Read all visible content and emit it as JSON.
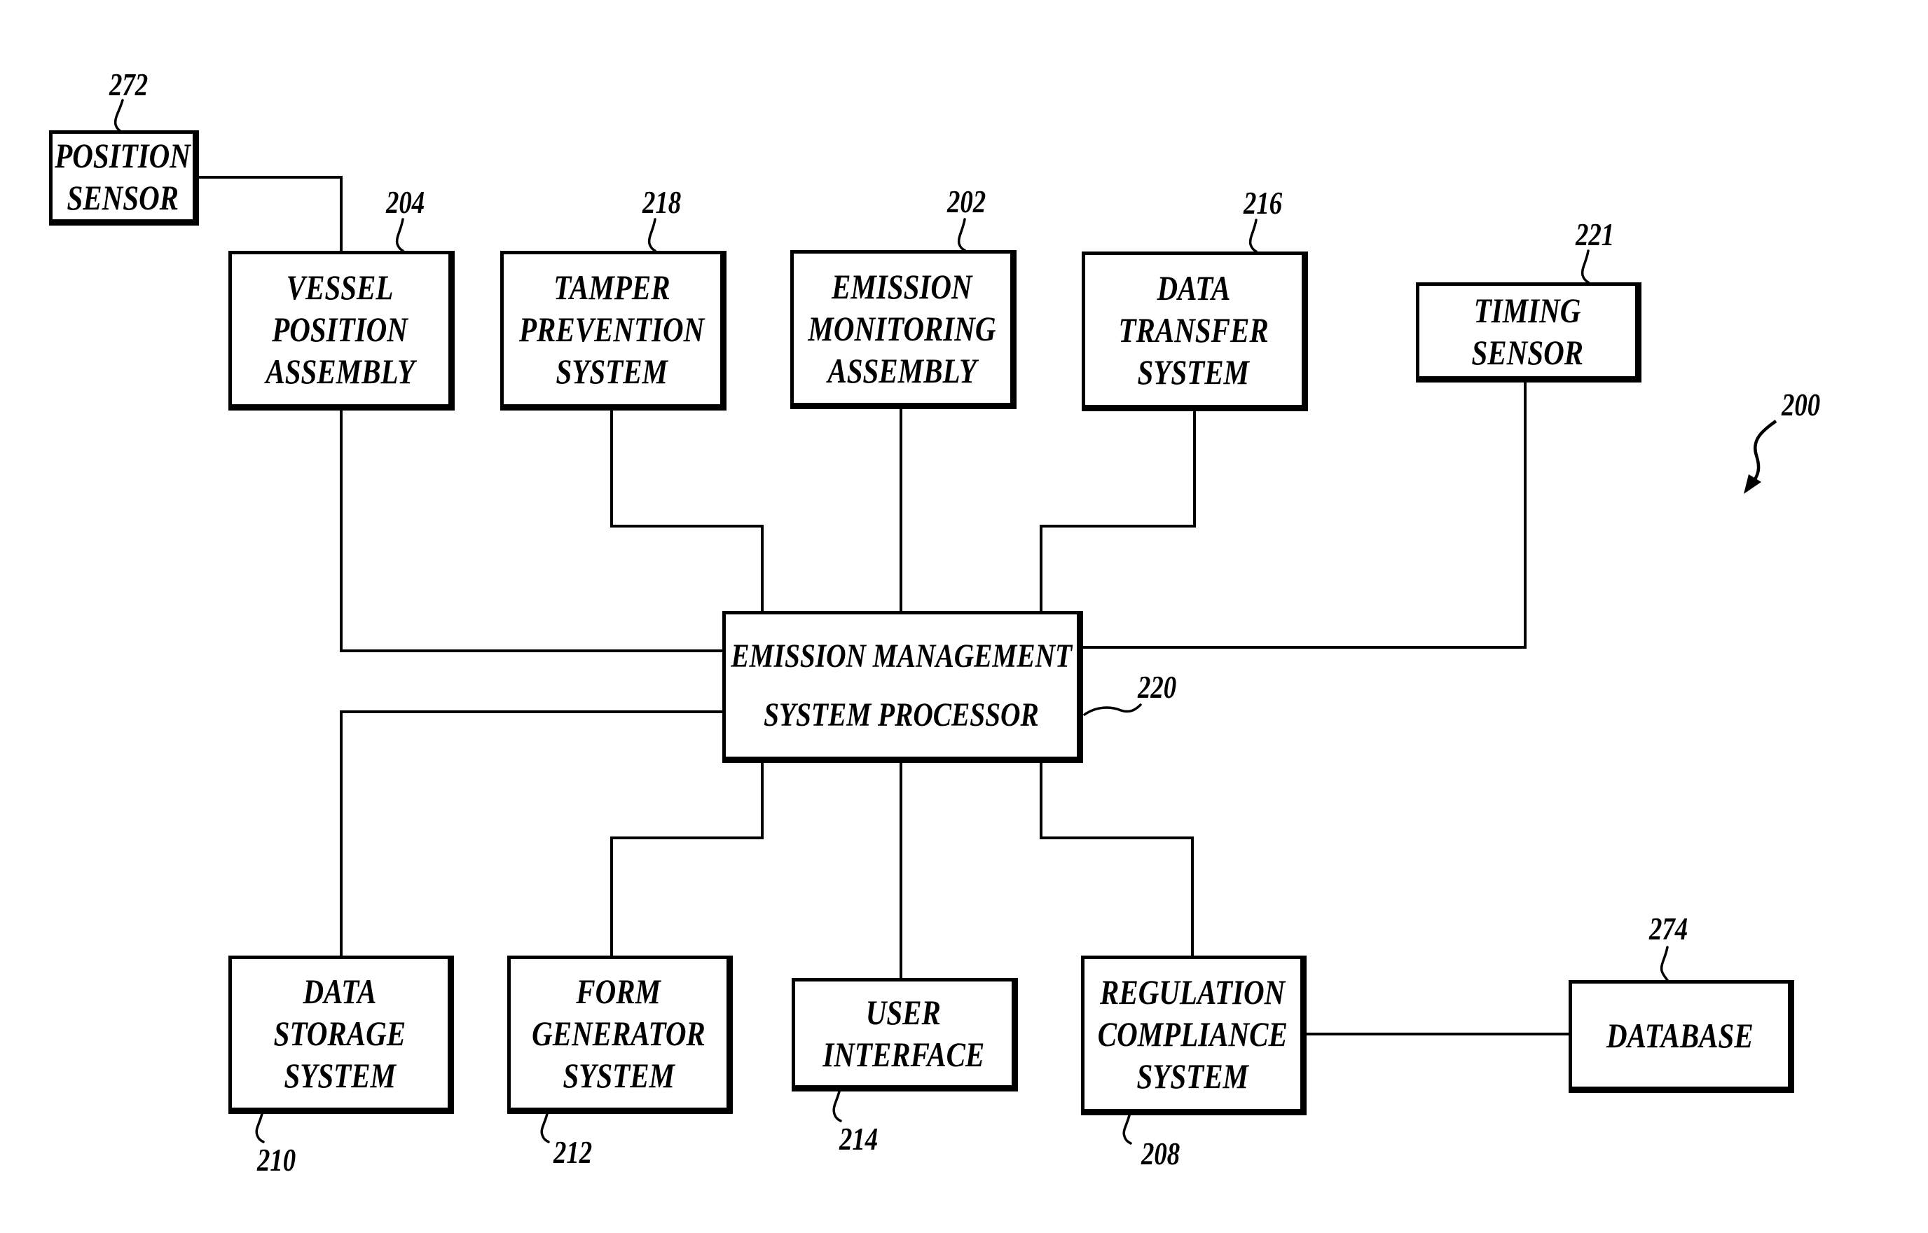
{
  "figure": {
    "reference": "200"
  },
  "blocks": {
    "position_sensor": {
      "lines": [
        "POSITION",
        "SENSOR"
      ],
      "ref": "272"
    },
    "vessel_position_assembly": {
      "lines": [
        "VESSEL",
        "POSITION",
        "ASSEMBLY"
      ],
      "ref": "204"
    },
    "tamper_prevention_system": {
      "lines": [
        "TAMPER",
        "PREVENTION",
        "SYSTEM"
      ],
      "ref": "218"
    },
    "emission_monitoring_assembly": {
      "lines": [
        "EMISSION",
        "MONITORING",
        "ASSEMBLY"
      ],
      "ref": "202"
    },
    "data_transfer_system": {
      "lines": [
        "DATA",
        "TRANSFER",
        "SYSTEM"
      ],
      "ref": "216"
    },
    "timing_sensor": {
      "lines": [
        "TIMING",
        "SENSOR"
      ],
      "ref": "221"
    },
    "processor": {
      "lines": [
        "EMISSION MANAGEMENT",
        "SYSTEM PROCESSOR"
      ],
      "ref": "220"
    },
    "data_storage_system": {
      "lines": [
        "DATA",
        "STORAGE",
        "SYSTEM"
      ],
      "ref": "210"
    },
    "form_generator_system": {
      "lines": [
        "FORM",
        "GENERATOR",
        "SYSTEM"
      ],
      "ref": "212"
    },
    "user_interface": {
      "lines": [
        "USER",
        "INTERFACE"
      ],
      "ref": "214"
    },
    "regulation_compliance_system": {
      "lines": [
        "REGULATION",
        "COMPLIANCE",
        "SYSTEM"
      ],
      "ref": "208"
    },
    "database": {
      "lines": [
        "DATABASE"
      ],
      "ref": "274"
    }
  },
  "connections": [
    [
      "position_sensor",
      "vessel_position_assembly"
    ],
    [
      "vessel_position_assembly",
      "processor"
    ],
    [
      "tamper_prevention_system",
      "processor"
    ],
    [
      "emission_monitoring_assembly",
      "processor"
    ],
    [
      "data_transfer_system",
      "processor"
    ],
    [
      "timing_sensor",
      "processor"
    ],
    [
      "processor",
      "data_storage_system"
    ],
    [
      "processor",
      "form_generator_system"
    ],
    [
      "processor",
      "user_interface"
    ],
    [
      "processor",
      "regulation_compliance_system"
    ],
    [
      "regulation_compliance_system",
      "database"
    ]
  ]
}
